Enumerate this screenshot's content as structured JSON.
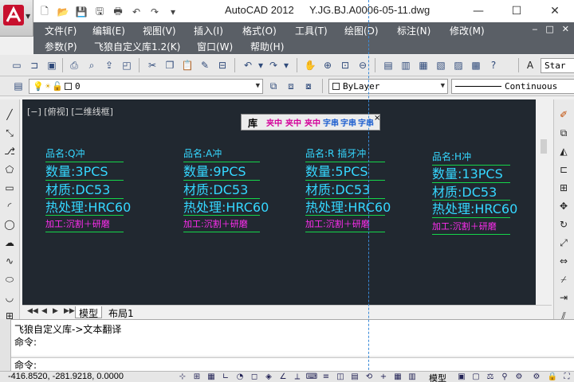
{
  "window": {
    "app_title": "AutoCAD 2012",
    "document_title": "Y.JG.BJ.A0006-05-11.dwg",
    "minimize_glyph": "—",
    "maximize_glyph": "☐",
    "close_glyph": "✕"
  },
  "quick_access": {
    "icons": [
      "new-icon",
      "open-icon",
      "save-icon",
      "saveas-icon",
      "print-icon",
      "undo-icon",
      "redo-icon",
      "dropdown-icon"
    ],
    "glyphs": [
      "🗋",
      "📂",
      "💾",
      "🖫",
      "🖶",
      "↶",
      "↷",
      "▾"
    ]
  },
  "menu_row1": [
    "文件(F)",
    "编辑(E)",
    "视图(V)",
    "插入(I)",
    "格式(O)",
    "工具(T)",
    "绘图(D)",
    "标注(N)",
    "修改(M)"
  ],
  "menu_row2": [
    "参数(P)",
    "飞狼自定义库1.2(K)",
    "窗口(W)",
    "帮助(H)"
  ],
  "mdi_controls": [
    "‒",
    "□",
    "✕"
  ],
  "toolbar2": {
    "layer_value": "0",
    "color_value": "ByLayer",
    "linetype_value": "Continuous",
    "text_style_value": "Star"
  },
  "viewport_label": "[−] [俯视] [二维线框]",
  "float_toolbar": {
    "title": "库",
    "buttons": [
      "夹中",
      "夹中",
      "夹中",
      "字串",
      "字串",
      "字串"
    ],
    "close_glyph": "×"
  },
  "parts": [
    {
      "name": "品名:Q冲",
      "qty": "数量:3PCS",
      "material": "材质:DC53",
      "heat": "热处理:HRC60",
      "process": "加工:沉割＋研磨"
    },
    {
      "name": "品名:A冲",
      "qty": "数量:9PCS",
      "material": "材质:DC53",
      "heat": "热处理:HRC60",
      "process": "加工:沉割＋研磨"
    },
    {
      "name": "品名:R  插牙冲",
      "qty": "数量:5PCS",
      "material": "材质:DC53",
      "heat": "热处理:HRC60",
      "process": "加工:沉割＋研磨"
    },
    {
      "name": "品名:H冲",
      "qty": "数量:13PCS",
      "material": "材质:DC53",
      "heat": "热处理:HRC60",
      "process": "加工:沉割＋研磨"
    }
  ],
  "layout_tabs": {
    "nav": [
      "◀◀",
      "◀",
      "▶",
      "▶▶"
    ],
    "model": "模型",
    "layout1": "布局1"
  },
  "command": {
    "history_line1": "飞狼自定义库->文本翻译",
    "history_line2": "命令:",
    "prompt": "命令:"
  },
  "status": {
    "coordinates": "-416.8520, -281.9218, 0.0000",
    "model_label": "模型"
  },
  "colors": {
    "drawing_bg": "#212830",
    "cyan_text": "#35d7ff",
    "magenta_text": "#ff2df0",
    "underline_green": "#15d64a",
    "menu_bg": "#5a5f66"
  }
}
